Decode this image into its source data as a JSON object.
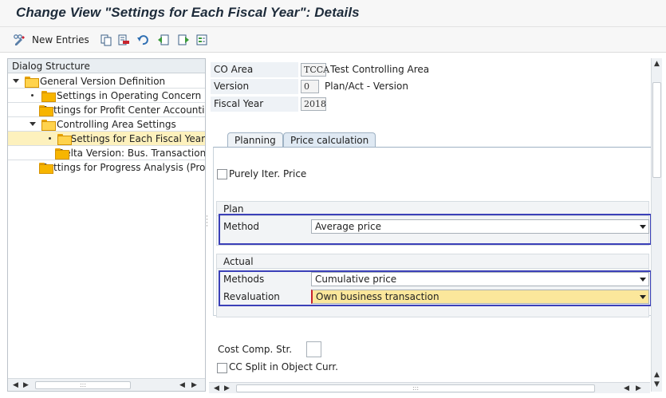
{
  "title": "Change View \"Settings for Each Fiscal Year\": Details",
  "toolbar": {
    "new_entries_label": "New Entries",
    "icons": [
      "display-change-icon",
      "copy-icon",
      "delete-icon",
      "undo-icon",
      "previous-entry-icon",
      "next-entry-icon",
      "select-all-icon"
    ]
  },
  "dialog": {
    "header": "Dialog Structure",
    "items": [
      {
        "label": "General Version Definition",
        "level": 0,
        "expanded": true
      },
      {
        "label": "Settings in Operating Concern",
        "level": 1
      },
      {
        "label": "Settings for Profit Center Accounting",
        "level": 1
      },
      {
        "label": "Controlling Area Settings",
        "level": 1,
        "expanded": true
      },
      {
        "label": "Settings for Each Fiscal Year",
        "level": 2,
        "selected": true
      },
      {
        "label": "Delta Version: Bus. Transactions",
        "level": 2
      },
      {
        "label": "Settings for Progress Analysis (Project)",
        "level": 0
      }
    ]
  },
  "header_fields": {
    "co_area": {
      "label": "CO Area",
      "value": "TCCA",
      "text": "Test Controlling Area"
    },
    "version": {
      "label": "Version",
      "value": "0",
      "text": "Plan/Act - Version"
    },
    "fiscal_year": {
      "label": "Fiscal Year",
      "value": "2018"
    }
  },
  "tabs": [
    {
      "label": "Planning",
      "active": false
    },
    {
      "label": "Price calculation",
      "active": true
    }
  ],
  "price_calc": {
    "purely_iter_label": "Purely Iter. Price",
    "plan": {
      "group_label": "Plan",
      "method_label": "Method",
      "method_value": "Average price"
    },
    "actual": {
      "group_label": "Actual",
      "methods_label": "Methods",
      "methods_value": "Cumulative price",
      "revaluation_label": "Revaluation",
      "revaluation_value": "Own business transaction"
    },
    "cost_comp_label": "Cost Comp. Str.",
    "cc_split_label": "CC Split in Object Curr."
  },
  "colors": {
    "highlight_box": "#3b40b8",
    "selected_row": "#fdf1bd",
    "focused_field": "#fbe79b"
  }
}
